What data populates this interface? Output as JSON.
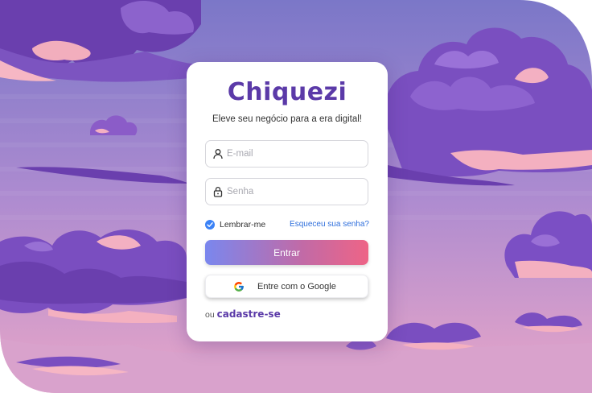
{
  "brand": {
    "name": "Chiquezi",
    "tagline": "Eleve seu negócio para a era digital!"
  },
  "form": {
    "email_placeholder": "E-mail",
    "password_placeholder": "Senha",
    "remember_label": "Lembrar-me",
    "remember_checked": true,
    "forgot_link": "Esqueceu sua senha?",
    "login_button": "Entrar",
    "google_button": "Entre com o Google",
    "signup_prefix": "ou",
    "signup_link": "cadastre-se"
  },
  "colors": {
    "brand": "#5b3aa8",
    "gradient_start": "#7a87ee",
    "gradient_end": "#ee6486",
    "link": "#2f6fdc",
    "checkbox": "#3b82f6",
    "sky_top": "#7b77c8",
    "sky_bottom": "#e8a6c8"
  },
  "icons": [
    "user-icon",
    "lock-icon",
    "check-icon",
    "google-icon"
  ]
}
